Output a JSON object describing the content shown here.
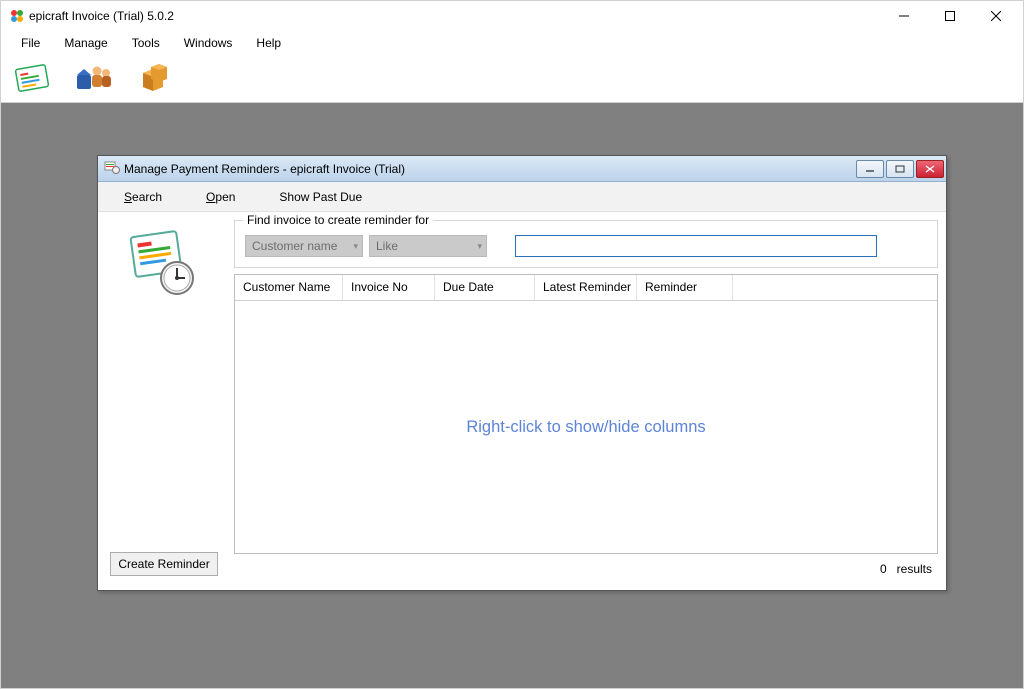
{
  "app": {
    "title": "epicraft Invoice (Trial) 5.0.2",
    "icon_name": "epicraft-logo-icon"
  },
  "window_controls": {
    "minimize_name": "minimize-icon",
    "maximize_name": "maximize-icon",
    "close_name": "close-icon"
  },
  "menubar": {
    "items": [
      "File",
      "Manage",
      "Tools",
      "Windows",
      "Help"
    ]
  },
  "toolbar": {
    "icons": [
      "invoice-icon",
      "customers-icon",
      "products-icon"
    ]
  },
  "child_window": {
    "title": "Manage Payment Reminders - epicraft Invoice (Trial)",
    "icon_name": "reminder-icon",
    "menu": {
      "search": "Search",
      "open": "Open",
      "show_past_due": "Show Past Due"
    },
    "groupbox_legend": "Find invoice to create reminder for",
    "filter": {
      "field_select": "Customer name",
      "op_select": "Like",
      "search_value": ""
    },
    "grid": {
      "columns": [
        "Customer Name",
        "Invoice No",
        "Due Date",
        "Latest Reminder",
        "Reminder"
      ],
      "hint": "Right-click to show/hide columns"
    },
    "results": {
      "count": "0",
      "label": "results"
    },
    "create_button": "Create Reminder"
  }
}
